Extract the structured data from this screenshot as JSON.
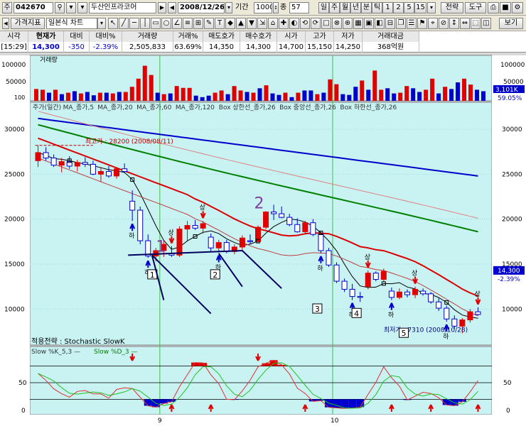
{
  "toolbar1": {
    "menu_glyph": "주",
    "code": "042670",
    "stock_name": "두산인프라코어",
    "date": "2008/12/26",
    "period_label": "기간",
    "period_value": "1000",
    "type_label": "종",
    "type_value": "57",
    "periods": [
      "일",
      "주",
      "월",
      "년",
      "분",
      "틱",
      "1",
      "2",
      "5",
      "15"
    ],
    "strategy_button": "전략",
    "tools_button": "도구"
  },
  "toolbar2": {
    "indicator_button": "가격지표",
    "chart_type": "일본식 차트",
    "view_button": "보기"
  },
  "quote": {
    "headers": [
      "시각",
      "현재가",
      "대비",
      "대비%",
      "거래량",
      "거래%",
      "매도호가",
      "매수호가",
      "시가",
      "고가",
      "저가",
      "거래대금"
    ],
    "values": [
      "[15:29]",
      "14,300",
      "-350",
      "-2.39%",
      "2,505,833",
      "63.69%",
      "14,350",
      "14,300",
      "14,700",
      "15,150",
      "14,250",
      "368억원"
    ]
  },
  "colors": {
    "up": "#e00000",
    "down": "#0000cc",
    "bg": "#c9f3f3",
    "ma5": "#000000",
    "ma20": "#dd0000",
    "ma60": "#008000",
    "ma120": "#0000cc",
    "boxu": "#e06060",
    "bk": "#000060"
  },
  "volume_panel": {
    "title": "거래량",
    "axis_labels": [
      "100000",
      "50000",
      "100",
      "100000",
      "50000"
    ],
    "last_value": "3,101K",
    "last_pct": "59.05%",
    "bars_k": [
      32,
      30,
      22,
      30,
      18,
      22,
      26,
      20,
      24,
      15,
      22,
      22,
      20,
      24,
      24,
      38,
      60,
      95,
      70,
      22,
      18,
      20,
      40,
      35,
      35,
      14,
      10,
      14,
      22,
      28,
      18,
      40,
      28,
      24,
      22,
      34,
      42,
      20,
      16,
      22,
      10,
      22,
      28,
      28,
      18,
      22,
      58,
      45,
      18,
      16,
      38,
      55,
      30,
      82,
      30,
      34,
      20,
      22,
      40,
      34,
      24,
      30,
      60,
      20,
      38,
      32,
      50,
      60,
      44,
      30,
      26
    ],
    "bars_up": [
      1,
      1,
      0,
      1,
      0,
      1,
      0,
      1,
      0,
      0,
      1,
      0,
      1,
      0,
      1,
      1,
      1,
      1,
      1,
      0,
      1,
      0,
      1,
      1,
      1,
      0,
      0,
      0,
      1,
      1,
      0,
      1,
      1,
      0,
      1,
      0,
      1,
      0,
      0,
      1,
      0,
      1,
      0,
      0,
      1,
      0,
      1,
      1,
      0,
      0,
      0,
      1,
      0,
      1,
      1,
      0,
      0,
      1,
      1,
      0,
      0,
      1,
      1,
      0,
      1,
      0,
      0,
      1,
      1,
      0,
      0
    ]
  },
  "price_panel": {
    "legend": [
      "주가(일간)",
      "MA_종가,5",
      "MA_종가,20",
      "MA_종가,60",
      "MA_종가,120",
      "Box 상한선_종가,26",
      "Box 중앙선_종가,26",
      "Box 하한선_종가,26"
    ],
    "axis_labels": [
      "30000",
      "25000",
      "20000",
      "15000",
      "10000"
    ],
    "high_label": "최고가 : 28200 (2008/08/11)",
    "low_label": "최저가 : 7310 (2008/10/28)",
    "current_price": "14,300",
    "current_pct": "-2.39%",
    "up_mark": "상",
    "down_mark": "하",
    "box_labels": [
      "1",
      "2",
      "3",
      "4",
      "5"
    ],
    "handwritten": [
      "1",
      "2"
    ]
  },
  "stoch_panel": {
    "title": "적용전략 : Stochastic SlowK",
    "legend": [
      "Slow %K_5,3",
      "Slow %D_3"
    ],
    "axis_labels": [
      "50",
      "0"
    ]
  },
  "x_axis": {
    "labels": [
      "9",
      "10"
    ]
  },
  "chart_data": {
    "type": "candlestick",
    "title": "",
    "x_labels": [
      "9",
      "10"
    ],
    "y_ticks": [
      10000,
      15000,
      20000,
      25000,
      30000
    ],
    "ylim": [
      6000,
      33000
    ],
    "candles": [
      [
        26500,
        28200,
        25800,
        27400
      ],
      [
        27400,
        28000,
        26500,
        26800
      ],
      [
        26800,
        27200,
        25800,
        26000
      ],
      [
        26000,
        26800,
        25200,
        26400
      ],
      [
        26400,
        27000,
        25600,
        25900
      ],
      [
        25900,
        26600,
        25300,
        26300
      ],
      [
        26300,
        26900,
        25800,
        26100
      ],
      [
        26100,
        26500,
        24900,
        25000
      ],
      [
        25000,
        25800,
        24200,
        25300
      ],
      [
        25300,
        25900,
        24600,
        24800
      ],
      [
        24800,
        25800,
        24500,
        25600
      ],
      [
        25600,
        26200,
        25100,
        25300
      ],
      [
        22000,
        23200,
        19800,
        21000
      ],
      [
        21000,
        21400,
        17200,
        17600
      ],
      [
        17600,
        18300,
        15700,
        15900
      ],
      [
        15900,
        16800,
        15300,
        16500
      ],
      [
        16500,
        17600,
        15800,
        17200
      ],
      [
        16200,
        17000,
        15800,
        16000
      ],
      [
        16000,
        19200,
        15800,
        18900
      ],
      [
        18900,
        19800,
        17600,
        19300
      ],
      [
        19300,
        19900,
        18800,
        19000
      ],
      [
        19000,
        19800,
        18400,
        19500
      ],
      [
        18000,
        18400,
        16400,
        16800
      ],
      [
        16800,
        17700,
        16300,
        17400
      ],
      [
        17400,
        17700,
        16200,
        16400
      ],
      [
        16400,
        17200,
        16100,
        16900
      ],
      [
        16900,
        18200,
        16500,
        17900
      ],
      [
        17600,
        18300,
        17200,
        17500
      ],
      [
        17500,
        19300,
        17300,
        19100
      ],
      [
        19100,
        20900,
        18900,
        20800
      ],
      [
        20800,
        21600,
        19900,
        20600
      ],
      [
        20600,
        21400,
        20100,
        20200
      ],
      [
        20200,
        20600,
        19200,
        19400
      ],
      [
        19400,
        20100,
        18500,
        18600
      ],
      [
        18600,
        19800,
        18300,
        19600
      ],
      [
        19600,
        20000,
        18100,
        18300
      ],
      [
        18300,
        18600,
        16200,
        16500
      ],
      [
        16500,
        16800,
        14700,
        14900
      ],
      [
        14900,
        15200,
        12900,
        13100
      ],
      [
        13100,
        13400,
        11900,
        12200
      ],
      [
        12200,
        12800,
        11000,
        11400
      ],
      [
        11400,
        11900,
        10800,
        11300
      ],
      [
        12500,
        14300,
        12200,
        14000
      ],
      [
        14000,
        14200,
        13100,
        13300
      ],
      [
        13300,
        14500,
        13000,
        14200
      ],
      [
        12000,
        12400,
        11000,
        11300
      ],
      [
        11300,
        12300,
        11100,
        11900
      ],
      [
        11900,
        12200,
        11300,
        11600
      ],
      [
        11600,
        12500,
        11200,
        12200
      ],
      [
        12000,
        12300,
        11500,
        11700
      ],
      [
        11700,
        11900,
        10600,
        10800
      ],
      [
        10800,
        11200,
        9800,
        10100
      ],
      [
        10100,
        10400,
        8600,
        8900
      ],
      [
        8900,
        9300,
        7800,
        8100
      ],
      [
        8100,
        9000,
        7310,
        8800
      ],
      [
        8800,
        10000,
        8500,
        9700
      ],
      [
        9700,
        10200,
        9300,
        9400
      ]
    ]
  }
}
